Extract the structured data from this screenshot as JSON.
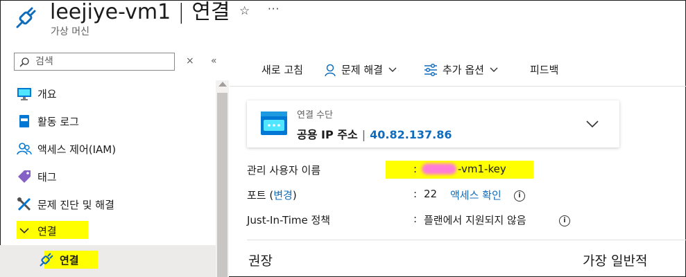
{
  "header": {
    "resource_name": "leejiye-vm1",
    "separator": "|",
    "page": "연결",
    "subtitle": "가상 머신",
    "star_glyph": "☆",
    "more_glyph": "···"
  },
  "sidebar": {
    "search_placeholder": "검색",
    "clear_glyph": "×",
    "collapse_glyph": "«",
    "items": [
      {
        "label": "개요",
        "icon": "monitor-icon"
      },
      {
        "label": "활동 로그",
        "icon": "activity-log-icon"
      },
      {
        "label": "액세스 제어(IAM)",
        "icon": "people-icon"
      },
      {
        "label": "태그",
        "icon": "tag-icon"
      },
      {
        "label": "문제 진단 및 해결",
        "icon": "wrench-icon"
      },
      {
        "label": "연결",
        "icon": "chevron-down-icon",
        "expanded": true
      },
      {
        "label": "연결",
        "icon": "plug-icon",
        "selected": true
      }
    ]
  },
  "toolbar": {
    "refresh": "새로 고침",
    "troubleshoot": "문제 해결",
    "more_options": "추가 옵션",
    "feedback": "피드백"
  },
  "connect_card": {
    "label": "연결 수단",
    "method": "공용 IP 주소",
    "separator": "|",
    "ip": "40.82.137.86"
  },
  "properties": [
    {
      "key": "관리 사용자 이름",
      "value_prefix": ":",
      "value": "-vm1-key"
    },
    {
      "key_prefix": "포트 (",
      "key_link": "변경",
      "key_suffix": ")",
      "value_prefix": ":",
      "value": "22",
      "link": "액세스 확인",
      "info": "i"
    },
    {
      "key": "Just-In-Time 정책",
      "value_prefix": ":",
      "value": "플랜에서 지원되지 않음",
      "info": "i"
    }
  ],
  "recommend": {
    "heading": "권장",
    "right": "가장 일반적"
  },
  "colors": {
    "accent": "#0f6cbd",
    "highlight": "#ffff00",
    "redaction": "#ff66ff"
  }
}
